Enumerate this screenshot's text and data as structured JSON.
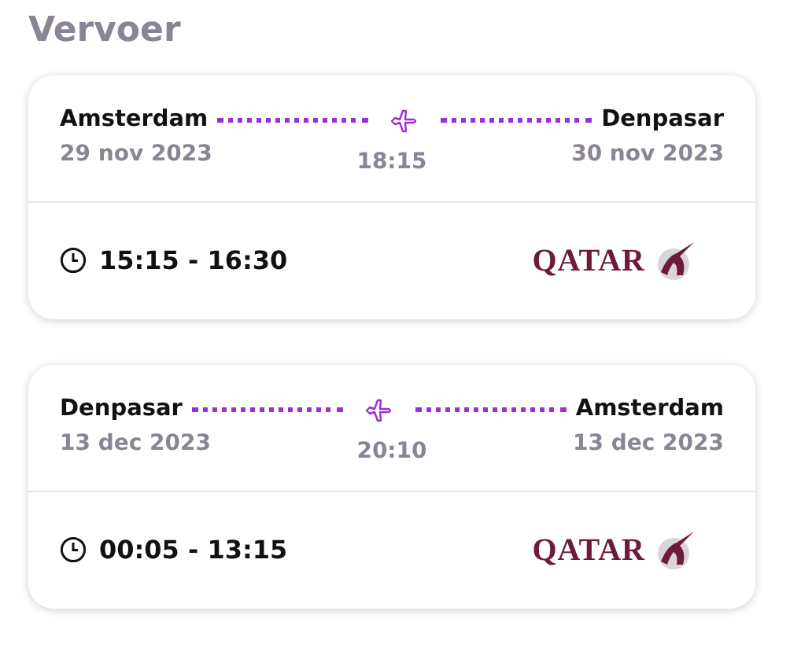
{
  "title": "Vervoer",
  "flights": [
    {
      "from": "Amsterdam",
      "to": "Denpasar",
      "depart_date": "29 nov 2023",
      "arrive_date": "30 nov 2023",
      "duration": "18:15",
      "times": "15:15 - 16:30",
      "airline": "QATAR"
    },
    {
      "from": "Denpasar",
      "to": "Amsterdam",
      "depart_date": "13 dec 2023",
      "arrive_date": "13 dec 2023",
      "duration": "20:10",
      "times": "00:05 - 13:15",
      "airline": "QATAR"
    }
  ]
}
